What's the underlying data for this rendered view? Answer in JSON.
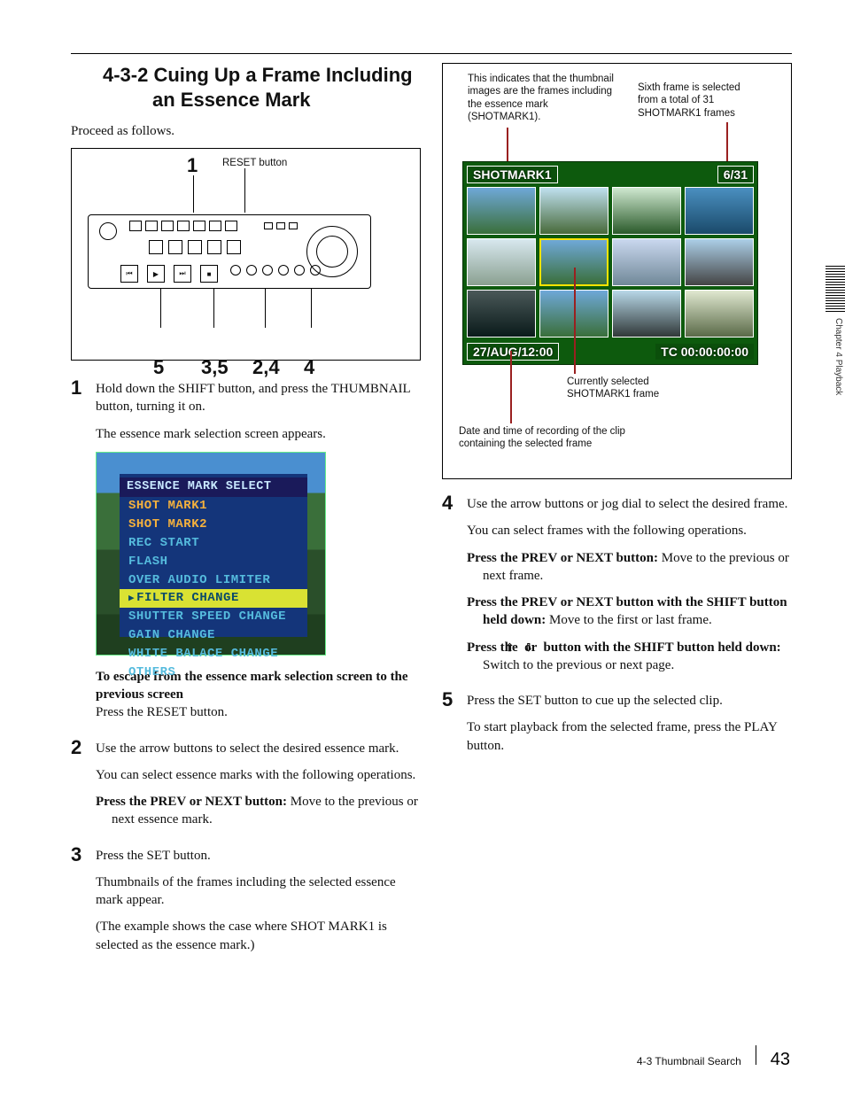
{
  "section_title": "4-3-2 Cuing Up a Frame Including an Essence Mark",
  "intro": "Proceed as follows.",
  "device_figure": {
    "top_num": "1",
    "reset_label": "RESET button",
    "bottom_nums": {
      "n5": "5",
      "n35": "3,5",
      "n24": "2,4",
      "n4": "4"
    }
  },
  "steps_left": [
    {
      "num": "1",
      "paras": [
        "Hold down the SHIFT button, and press the THUMBNAIL button, turning it on.",
        "The essence mark selection screen appears."
      ]
    }
  ],
  "essence_menu": {
    "title": "ESSENCE MARK SELECT",
    "items": [
      {
        "label": "SHOT MARK1",
        "style": "o"
      },
      {
        "label": "SHOT MARK2",
        "style": "o"
      },
      {
        "label": "REC START",
        "style": ""
      },
      {
        "label": "FLASH",
        "style": ""
      },
      {
        "label": "OVER AUDIO LIMITER",
        "style": ""
      },
      {
        "label": "FILTER CHANGE",
        "style": "sel"
      },
      {
        "label": "SHUTTER SPEED CHANGE",
        "style": ""
      },
      {
        "label": "GAIN CHANGE",
        "style": ""
      },
      {
        "label": "WHITE BALACE CHANGE",
        "style": ""
      },
      {
        "label": "OTHERS",
        "style": ""
      }
    ]
  },
  "after_essence": {
    "escape_bold": "To escape from the essence mark selection screen to the previous screen",
    "escape_action": "Press the RESET button."
  },
  "steps_left2": [
    {
      "num": "2",
      "paras": [
        "Use the arrow buttons to select the desired essence mark.",
        "You can select essence marks with the following operations."
      ],
      "hang": {
        "bold": "Press the PREV or NEXT button: ",
        "rest": "Move to the previous or next essence mark."
      }
    },
    {
      "num": "3",
      "paras": [
        "Press the SET button.",
        "Thumbnails of the frames including the selected essence mark appear.",
        "(The example shows the case where SHOT MARK1 is selected as the essence mark.)"
      ]
    }
  ],
  "right_figure": {
    "ann_top_left": "This indicates that the thumbnail images are the frames including the essence mark (SHOTMARK1).",
    "ann_top_right": "Sixth frame is selected from a total of 31 SHOTMARK1 frames",
    "shotmark_chip": "SHOTMARK1",
    "counter_chip": "6/31",
    "date_chip": "27/AUG/12:00",
    "tc_chip": "TC 00:00:00:00",
    "ann_mid": "Currently selected SHOTMARK1 frame",
    "ann_bot": "Date and time of recording of the clip containing the selected frame"
  },
  "steps_right": [
    {
      "num": "4",
      "paras": [
        "Use the arrow buttons or jog dial to select the desired frame.",
        "You can select frames with the following operations."
      ],
      "hangs": [
        {
          "bold": "Press the PREV or NEXT button: ",
          "rest": "Move to the previous or next frame."
        },
        {
          "bold": "Press the PREV or NEXT button with the SHIFT button held down: ",
          "rest": "Move to the first or last frame."
        },
        {
          "bold_pre": "Press the ",
          "bold_mid": " or ",
          "bold_post": " button with the SHIFT button held down: ",
          "rest": "Switch to the previous or next page."
        }
      ]
    },
    {
      "num": "5",
      "paras": [
        "Press the SET button to cue up the selected clip.",
        "To start playback from the selected frame, press the PLAY button."
      ]
    }
  ],
  "side_tab": "Chapter 4  Playback",
  "footer": {
    "section": "4-3 Thumbnail Search",
    "page": "43"
  }
}
